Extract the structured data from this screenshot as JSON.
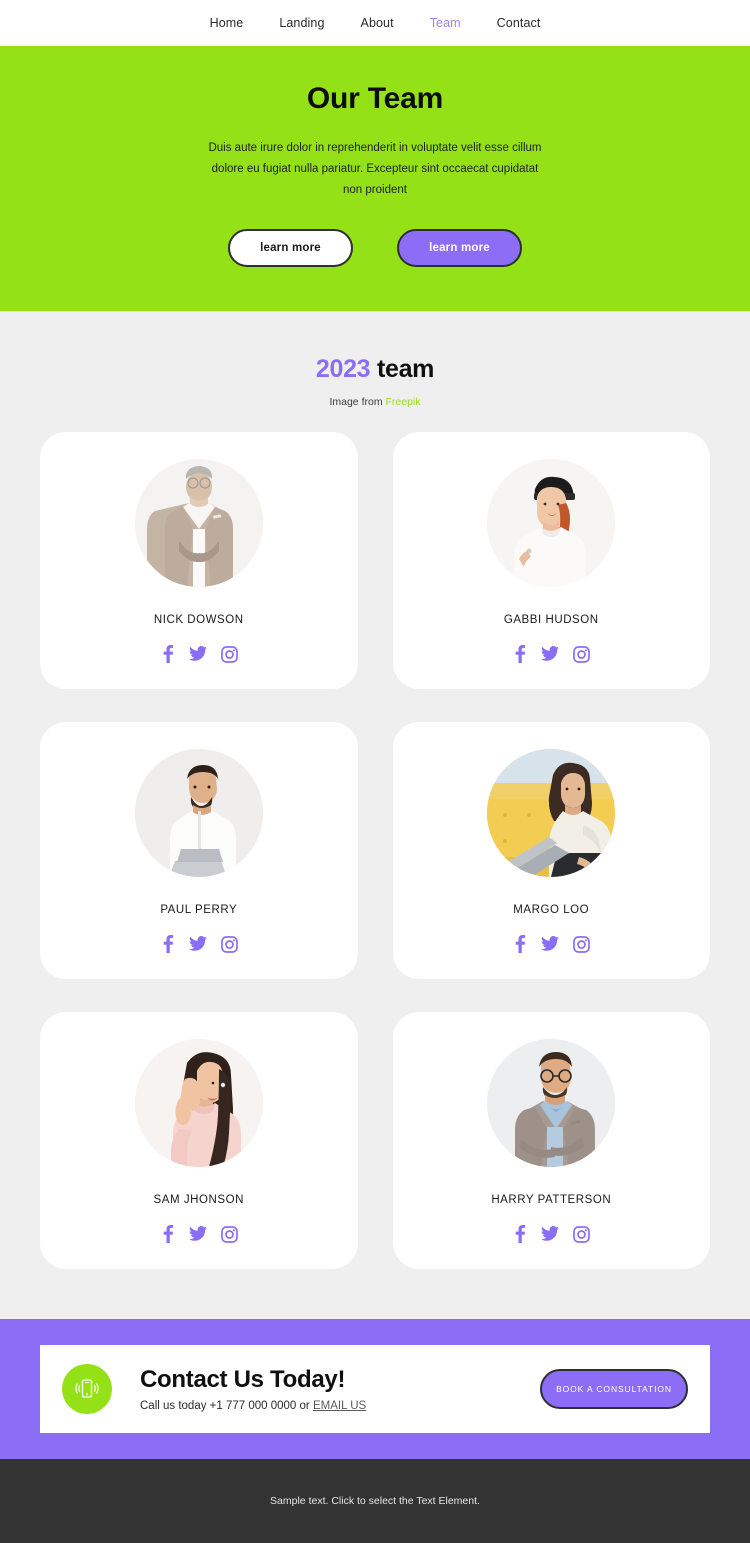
{
  "nav": {
    "items": [
      {
        "label": "Home",
        "active": false
      },
      {
        "label": "Landing",
        "active": false
      },
      {
        "label": "About",
        "active": false
      },
      {
        "label": "Team",
        "active": true
      },
      {
        "label": "Contact",
        "active": false
      }
    ]
  },
  "hero": {
    "title": "Our Team",
    "subtitle": "Duis aute irure dolor in reprehenderit in voluptate velit esse cillum dolore eu fugiat nulla pariatur. Excepteur sint occaecat cupidatat non proident",
    "button_primary": "learn more",
    "button_secondary": "learn more",
    "background_color": "#95e118"
  },
  "team": {
    "title_year": "2023",
    "title_word": " team",
    "credit_prefix": "Image from ",
    "credit_link": "Freepik",
    "members": [
      {
        "name": "NICK DOWSON",
        "photo": "mature-man-beige-suit"
      },
      {
        "name": "GABBI HUDSON",
        "photo": "woman-black-beanie-red-braid"
      },
      {
        "name": "PAUL PERRY",
        "photo": "man-white-shirt-laptop"
      },
      {
        "name": "MARGO LOO",
        "photo": "woman-yellow-sofa-laptop"
      },
      {
        "name": "SAM JHONSON",
        "photo": "woman-pink-hoodie-laughing"
      },
      {
        "name": "HARRY PATTERSON",
        "photo": "man-glasses-grey-blazer"
      }
    ],
    "social_icons": [
      "facebook-icon",
      "twitter-icon",
      "instagram-icon"
    ],
    "accent_color": "#8b6ef5"
  },
  "cta": {
    "icon": "mobile-phone-icon",
    "title": "Contact Us Today!",
    "text_before": "Call us today +1 777 000 0000 or ",
    "email_link": "EMAIL US",
    "button": "BOOK A CONSULTATION",
    "band_color": "#8b6ef5"
  },
  "footer": {
    "text": "Sample text. Click to select the Text Element.",
    "background_color": "#333333"
  }
}
